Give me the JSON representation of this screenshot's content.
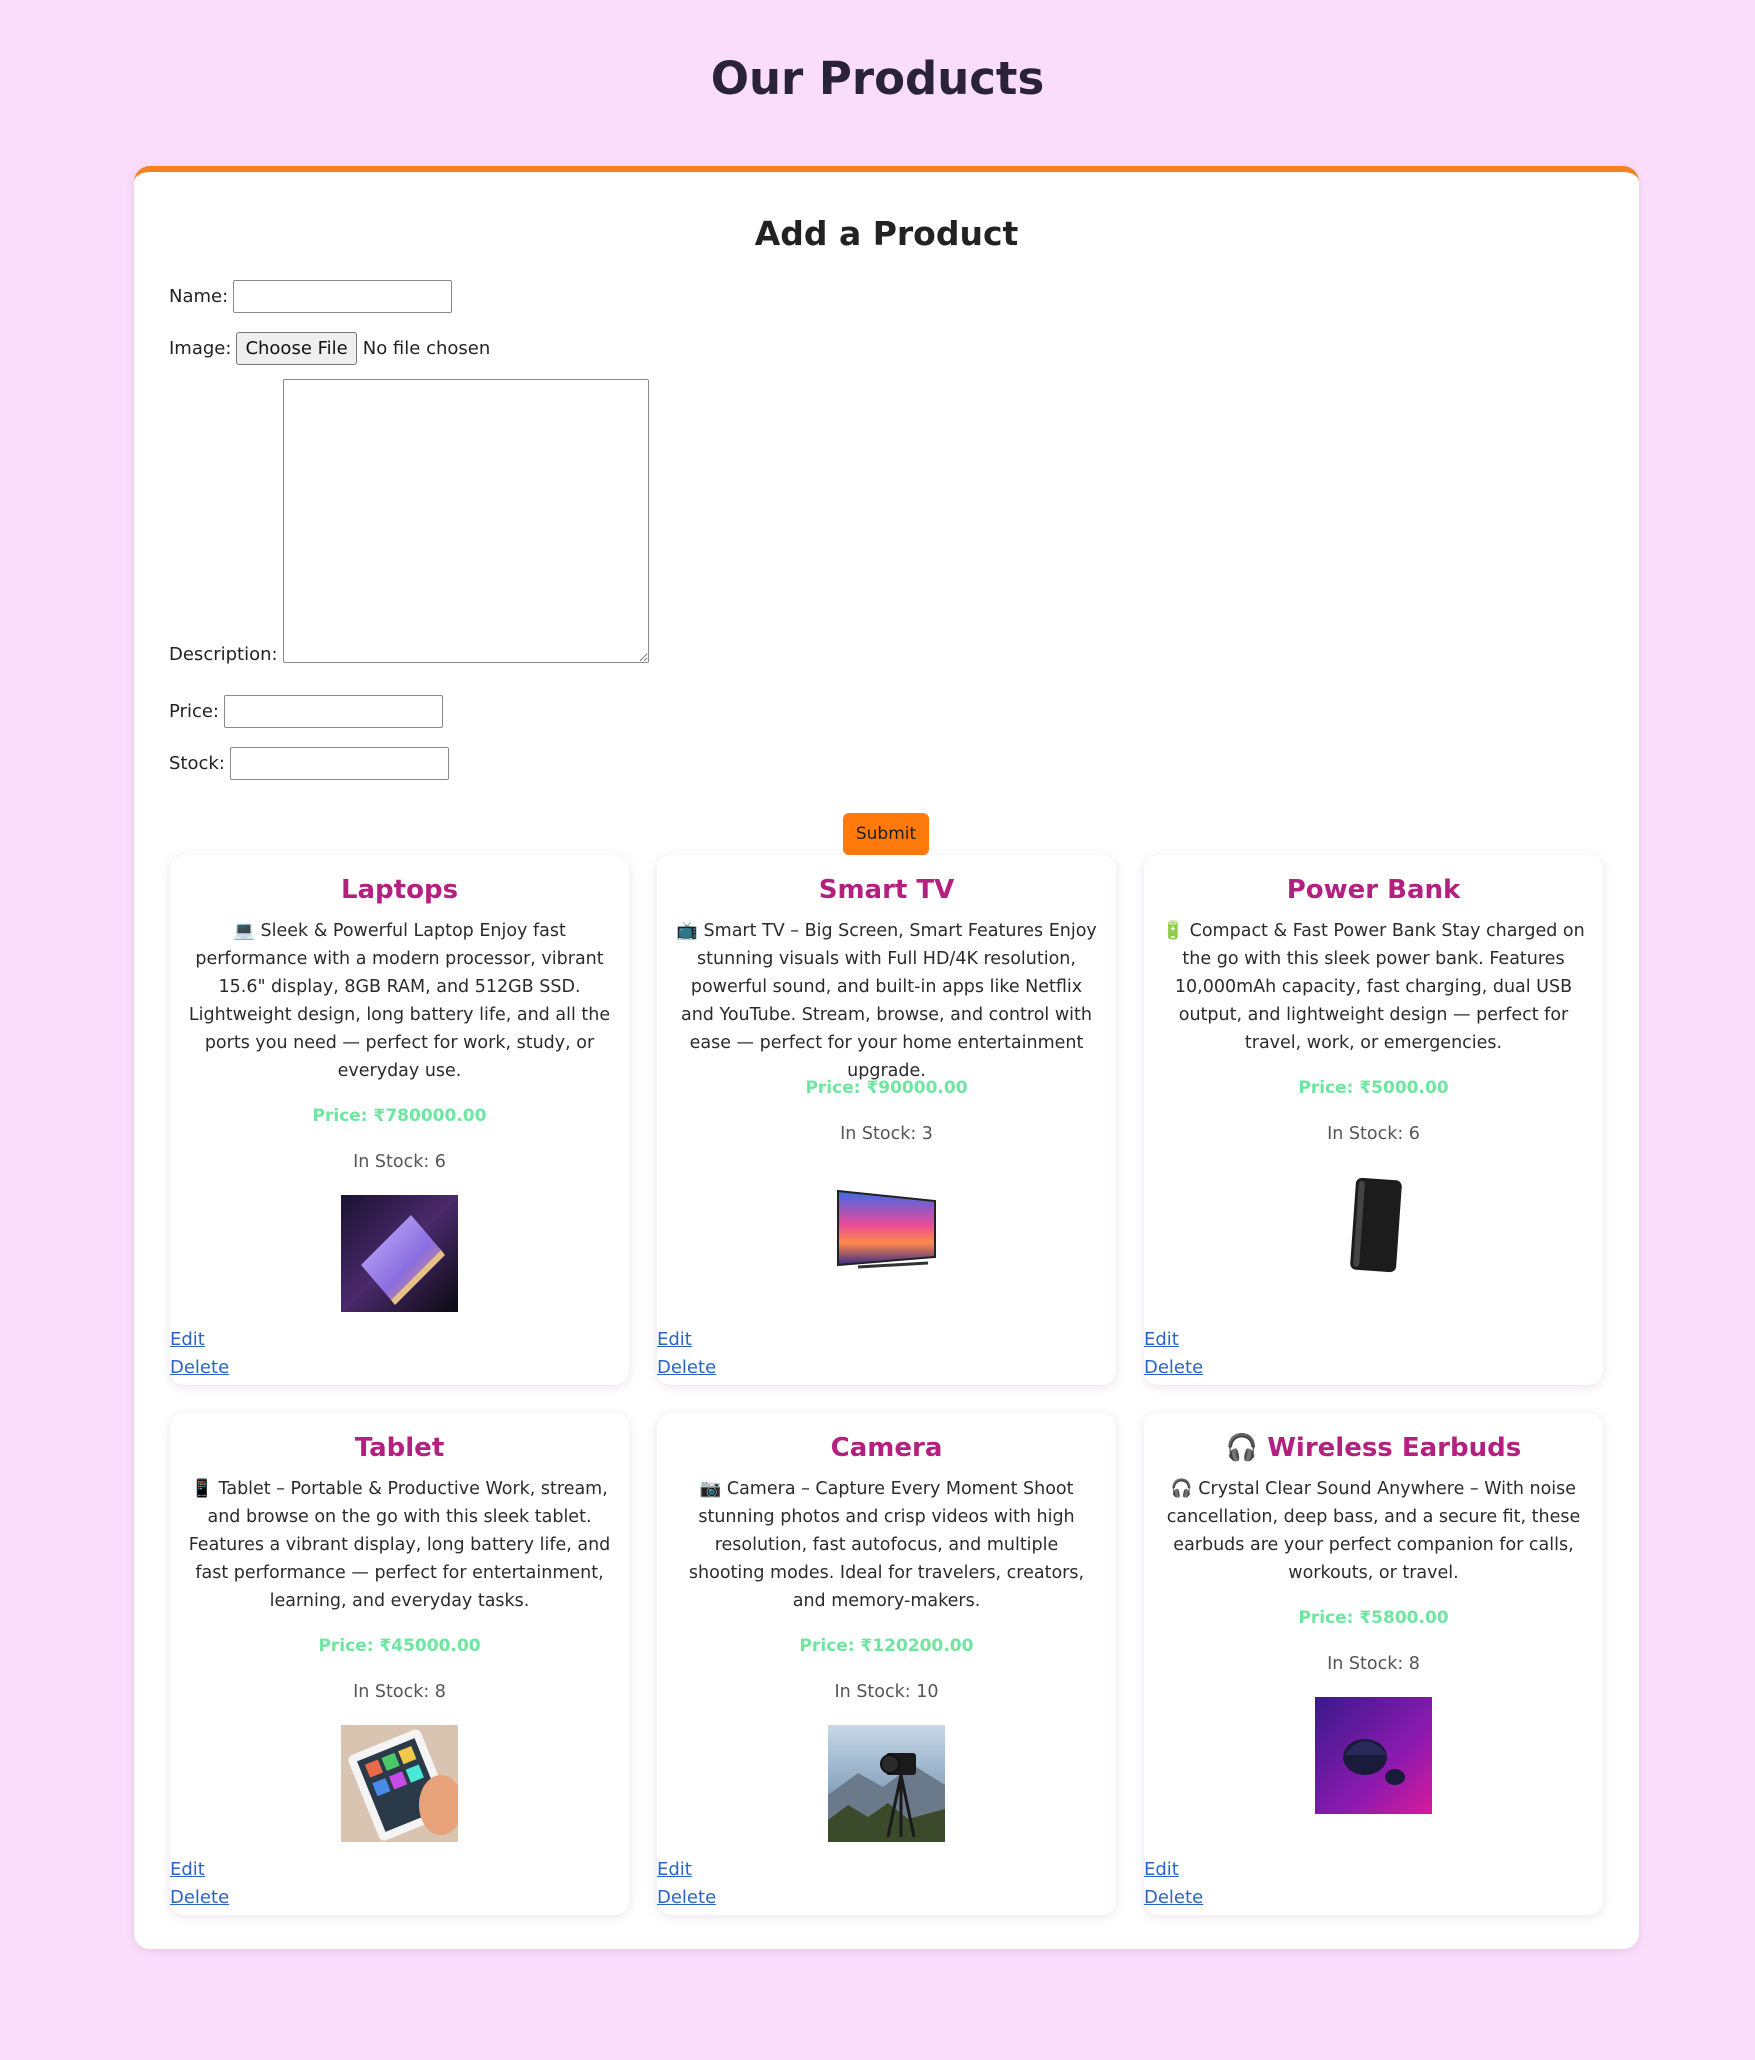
{
  "page": {
    "title": "Our Products"
  },
  "form": {
    "title": "Add a Product",
    "name_label": "Name:",
    "name_value": "",
    "image_label": "Image:",
    "file_button": "Choose File",
    "file_status": "No file chosen",
    "description_label": "Description:",
    "description_value": "",
    "price_label": "Price:",
    "price_value": "",
    "stock_label": "Stock:",
    "stock_value": "",
    "submit_label": "Submit"
  },
  "products": [
    {
      "name": "Laptops",
      "icon": "laptop-icon",
      "description": "💻 Sleek & Powerful Laptop Enjoy fast performance with a modern processor, vibrant 15.6\" display, 8GB RAM, and 512GB SSD. Lightweight design, long battery life, and all the ports you need — perfect for work, study, or everyday use.",
      "price": "Price: ₹780000.00",
      "stock": "In Stock: 6",
      "edit_label": "Edit",
      "delete_label": "Delete"
    },
    {
      "name": "Smart TV",
      "icon": "tv-icon",
      "description": "📺 Smart TV – Big Screen, Smart Features Enjoy stunning visuals with Full HD/4K resolution, powerful sound, and built-in apps like Netflix and YouTube. Stream, browse, and control with ease — perfect for your home entertainment upgrade.",
      "price": "Price: ₹90000.00",
      "stock": "In Stock: 3",
      "edit_label": "Edit",
      "delete_label": "Delete"
    },
    {
      "name": "Power Bank",
      "icon": "battery-icon",
      "description": "🔋 Compact & Fast Power Bank Stay charged on the go with this sleek power bank. Features 10,000mAh capacity, fast charging, dual USB output, and lightweight design — perfect for travel, work, or emergencies.",
      "price": "Price: ₹5000.00",
      "stock": "In Stock: 6",
      "edit_label": "Edit",
      "delete_label": "Delete"
    },
    {
      "name": "Tablet",
      "icon": "tablet-icon",
      "description": "📱 Tablet – Portable & Productive Work, stream, and browse on the go with this sleek tablet. Features a vibrant display, long battery life, and fast performance — perfect for entertainment, learning, and everyday tasks.",
      "price": "Price: ₹45000.00",
      "stock": "In Stock: 8",
      "edit_label": "Edit",
      "delete_label": "Delete"
    },
    {
      "name": "Camera",
      "icon": "camera-icon",
      "description": "📷 Camera – Capture Every Moment Shoot stunning photos and crisp videos with high resolution, fast autofocus, and multiple shooting modes. Ideal for travelers, creators, and memory-makers.",
      "price": "Price: ₹120200.00",
      "stock": "In Stock: 10",
      "edit_label": "Edit",
      "delete_label": "Delete"
    },
    {
      "name": "🎧 Wireless Earbuds",
      "icon": "headphones-icon",
      "description": "🎧 Crystal Clear Sound Anywhere – With noise cancellation, deep bass, and a secure fit, these earbuds are your perfect companion for calls, workouts, or travel.",
      "price": "Price: ₹5800.00",
      "stock": "In Stock: 8",
      "edit_label": "Edit",
      "delete_label": "Delete"
    }
  ],
  "colors": {
    "background": "#fadcfb",
    "accent": "#f5821f",
    "product_name": "#b3207f",
    "price": "#6ee6a0",
    "link": "#2b63c8"
  }
}
